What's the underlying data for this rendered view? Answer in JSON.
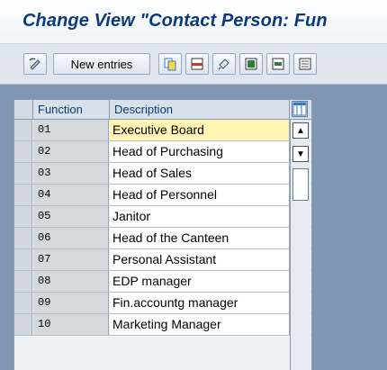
{
  "window": {
    "title": "Change View \"Contact Person: Fun"
  },
  "toolbar": {
    "items": [
      {
        "name": "change-display-icon",
        "label": ""
      },
      {
        "name": "new-entries-button",
        "label": "New entries"
      },
      {
        "name": "copy-icon",
        "label": ""
      },
      {
        "name": "delete-icon",
        "label": ""
      },
      {
        "name": "undo-icon",
        "label": ""
      },
      {
        "name": "select-all-icon",
        "label": ""
      },
      {
        "name": "select-block-icon",
        "label": ""
      },
      {
        "name": "deselect-all-icon",
        "label": ""
      }
    ],
    "colors": {
      "copy": "#3a77c6",
      "delete": "#c83a2f",
      "select": "#2f7d3e"
    }
  },
  "table": {
    "columns": [
      "Function",
      "Description"
    ],
    "active_row": 0,
    "rows": [
      {
        "function": "01",
        "description": "Executive Board"
      },
      {
        "function": "02",
        "description": "Head of Purchasing"
      },
      {
        "function": "03",
        "description": "Head of Sales"
      },
      {
        "function": "04",
        "description": "Head of Personnel"
      },
      {
        "function": "05",
        "description": "Janitor"
      },
      {
        "function": "06",
        "description": "Head of the Canteen"
      },
      {
        "function": "07",
        "description": "Personal Assistant"
      },
      {
        "function": "08",
        "description": "EDP manager"
      },
      {
        "function": "09",
        "description": "Fin.accountg manager"
      },
      {
        "function": "10",
        "description": "Marketing Manager"
      }
    ]
  },
  "scrollbar": {
    "up": "▲",
    "down": "▼"
  }
}
